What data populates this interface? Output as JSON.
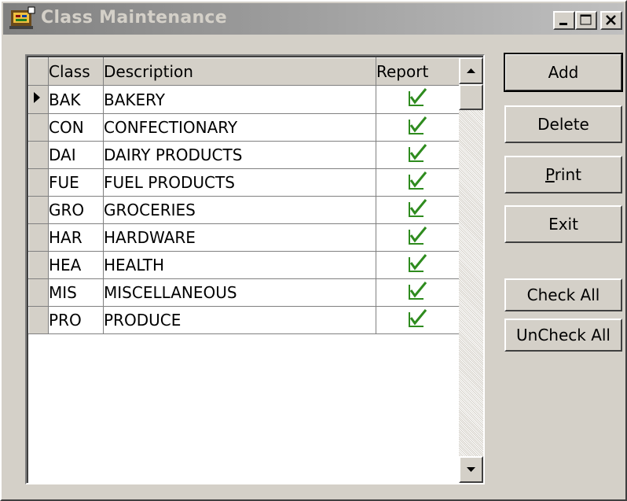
{
  "window": {
    "title": "Class Maintenance",
    "minimize_icon": "minimize-icon",
    "maximize_icon": "maximize-icon",
    "close_icon": "close-icon"
  },
  "grid": {
    "columns": [
      "Class",
      "Description",
      "Report"
    ],
    "rows": [
      {
        "class": "BAK",
        "description": "BAKERY",
        "report": true
      },
      {
        "class": "CON",
        "description": "CONFECTIONARY",
        "report": true
      },
      {
        "class": "DAI",
        "description": "DAIRY PRODUCTS",
        "report": true
      },
      {
        "class": "FUE",
        "description": "FUEL PRODUCTS",
        "report": true
      },
      {
        "class": "GRO",
        "description": "GROCERIES",
        "report": true
      },
      {
        "class": "HAR",
        "description": "HARDWARE",
        "report": true
      },
      {
        "class": "HEA",
        "description": "HEALTH",
        "report": true
      },
      {
        "class": "MIS",
        "description": "MISCELLANEOUS",
        "report": true
      },
      {
        "class": "PRO",
        "description": "PRODUCE",
        "report": true
      }
    ],
    "current_row_indicator": "row-pointer-icon",
    "check_icon": "checkmark-icon",
    "check_color": "#2e8b1e"
  },
  "buttons": {
    "add": "Add",
    "delete": "Delete",
    "print": "Print",
    "exit": "Exit",
    "check_all": "Check All",
    "uncheck_all": "UnCheck All"
  }
}
